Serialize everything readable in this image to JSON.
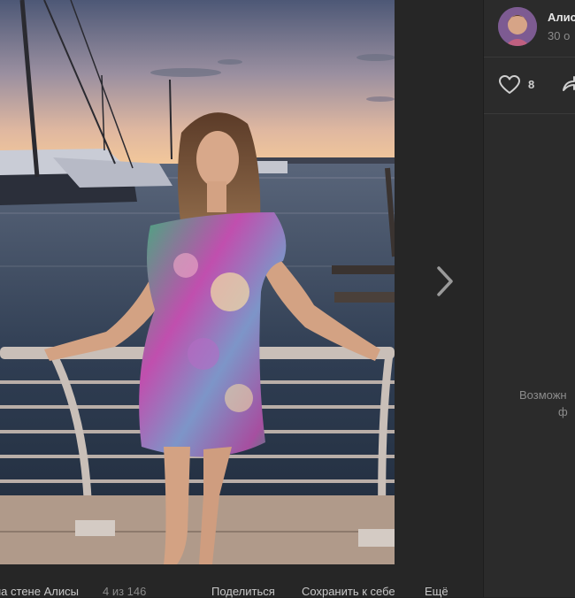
{
  "viewer": {
    "photo_alt": "Фото",
    "footer": {
      "album_label": "на стене Алисы",
      "counter": "4 из 146",
      "share_label": "Поделиться",
      "save_label": "Сохранить к себе",
      "more_label": "Ещё"
    }
  },
  "sidebar": {
    "author_name": "Алис",
    "post_date": "30 о",
    "likes_count": "8",
    "hint_line1": "Возможн",
    "hint_line2": "ф"
  },
  "colors": {
    "panel_bg": "#2b2b2b",
    "viewer_bg": "#262626",
    "text_primary": "#e6e6e6",
    "text_muted": "#8c8c8c"
  },
  "icons": [
    "chevron-right-icon",
    "heart-icon",
    "share-icon"
  ]
}
